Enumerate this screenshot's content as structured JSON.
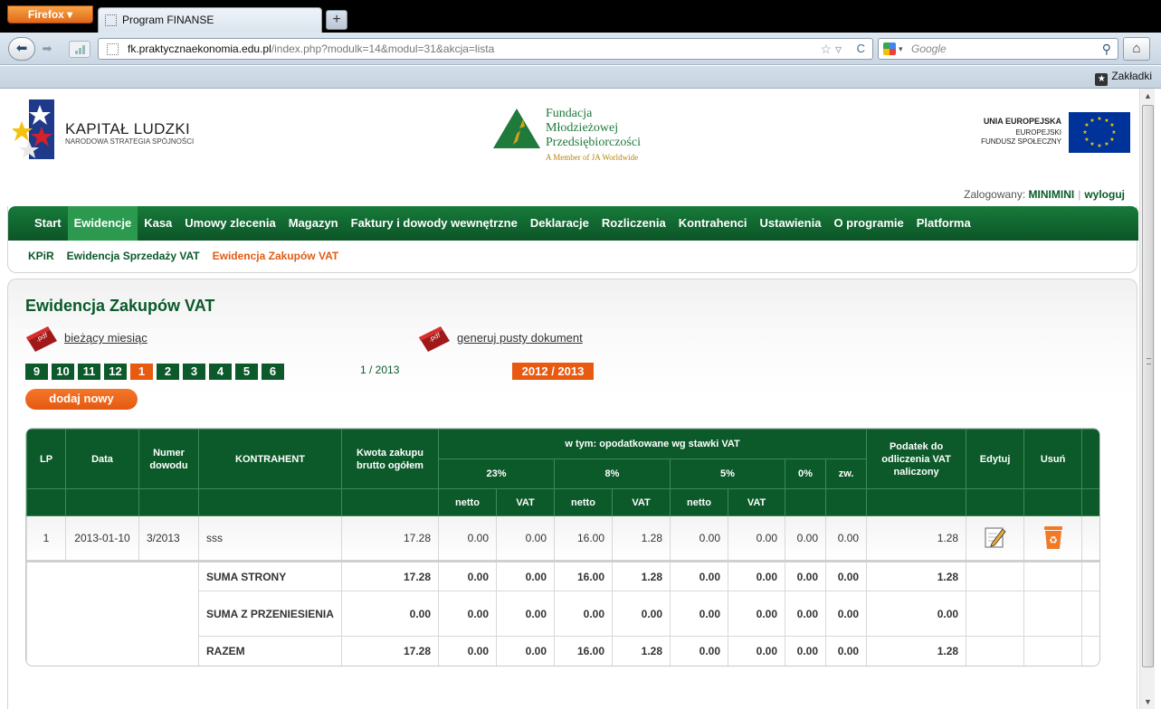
{
  "browser": {
    "menu_button": "Firefox",
    "tab_title": "Program FINANSE",
    "new_tab": "+",
    "url_host": "fk.praktycznaekonomia.edu.pl",
    "url_path": "/index.php?modulk=14&modul=31&akcja=lista",
    "search_placeholder": "Google",
    "bookmarks_label": "Zakładki"
  },
  "logos": {
    "kl_title": "KAPITAŁ LUDZKI",
    "kl_sub": "NARODOWA STRATEGIA SPÓJNOŚCI",
    "fmp_line1": "Fundacja",
    "fmp_line2": "Młodzieżowej",
    "fmp_line3": "Przedsiębiorczości",
    "fmp_sub": "A Member of JA Worldwide",
    "ue_title": "UNIA EUROPEJSKA",
    "ue_sub1": "EUROPEJSKI",
    "ue_sub2": "FUNDUSZ SPOŁECZNY"
  },
  "user": {
    "logged_label": "Zalogowany:",
    "username": "MINIMINI",
    "logout": "wyloguj"
  },
  "main_menu": [
    {
      "label": "Start"
    },
    {
      "label": "Ewidencje",
      "active": true
    },
    {
      "label": "Kasa"
    },
    {
      "label": "Umowy zlecenia"
    },
    {
      "label": "Magazyn"
    },
    {
      "label": "Faktury i dowody wewnętrzne"
    },
    {
      "label": "Deklaracje"
    },
    {
      "label": "Rozliczenia"
    },
    {
      "label": "Kontrahenci"
    },
    {
      "label": "Ustawienia"
    },
    {
      "label": "O programie"
    },
    {
      "label": "Platforma"
    }
  ],
  "sub_menu": [
    {
      "label": "KPiR"
    },
    {
      "label": "Ewidencja Sprzedaży VAT"
    },
    {
      "label": "Ewidencja Zakupów VAT",
      "active": true
    }
  ],
  "page": {
    "title": "Ewidencja Zakupów VAT",
    "pdf_current": "bieżący miesiąc",
    "pdf_empty": "generuj pusty dokument",
    "pdf_badge": ".pdf",
    "months": [
      "9",
      "10",
      "11",
      "12",
      "1",
      "2",
      "3",
      "4",
      "5",
      "6"
    ],
    "active_month": "1",
    "period": "1 / 2013",
    "year": "2012 / 2013",
    "add_new": "dodaj nowy"
  },
  "table": {
    "headers": {
      "lp": "LP",
      "data": "Data",
      "numer": "Numer dowodu",
      "kontrahent": "KONTRAHENT",
      "kwota": "Kwota zakupu brutto ogółem",
      "w_tym": "w tym: opodatkowane wg stawki VAT",
      "r23": "23%",
      "r8": "8%",
      "r5": "5%",
      "r0": "0%",
      "zw": "zw.",
      "podatek": "Podatek do odliczenia VAT naliczony",
      "edytuj": "Edytuj",
      "usun": "Usuń",
      "netto": "netto",
      "vat": "VAT"
    },
    "row": {
      "lp": "1",
      "data": "2013-01-10",
      "numer": "3/2013",
      "kontrahent": "sss",
      "kwota": "17.28",
      "n23": "0.00",
      "v23": "0.00",
      "n8": "16.00",
      "v8": "1.28",
      "n5": "0.00",
      "v5": "0.00",
      "r0": "0.00",
      "zw": "0.00",
      "podatek": "1.28"
    },
    "sums": [
      {
        "label": "SUMA STRONY",
        "kwota": "17.28",
        "n23": "0.00",
        "v23": "0.00",
        "n8": "16.00",
        "v8": "1.28",
        "n5": "0.00",
        "v5": "0.00",
        "r0": "0.00",
        "zw": "0.00",
        "podatek": "1.28"
      },
      {
        "label": "SUMA Z PRZENIESIENIA",
        "kwota": "0.00",
        "n23": "0.00",
        "v23": "0.00",
        "n8": "0.00",
        "v8": "0.00",
        "n5": "0.00",
        "v5": "0.00",
        "r0": "0.00",
        "zw": "0.00",
        "podatek": "0.00"
      },
      {
        "label": "RAZEM",
        "kwota": "17.28",
        "n23": "0.00",
        "v23": "0.00",
        "n8": "16.00",
        "v8": "1.28",
        "n5": "0.00",
        "v5": "0.00",
        "r0": "0.00",
        "zw": "0.00",
        "podatek": "1.28"
      }
    ]
  },
  "colors": {
    "green_dark": "#0c5a2a",
    "green_menu": "#177a3a",
    "orange": "#e85a10"
  }
}
